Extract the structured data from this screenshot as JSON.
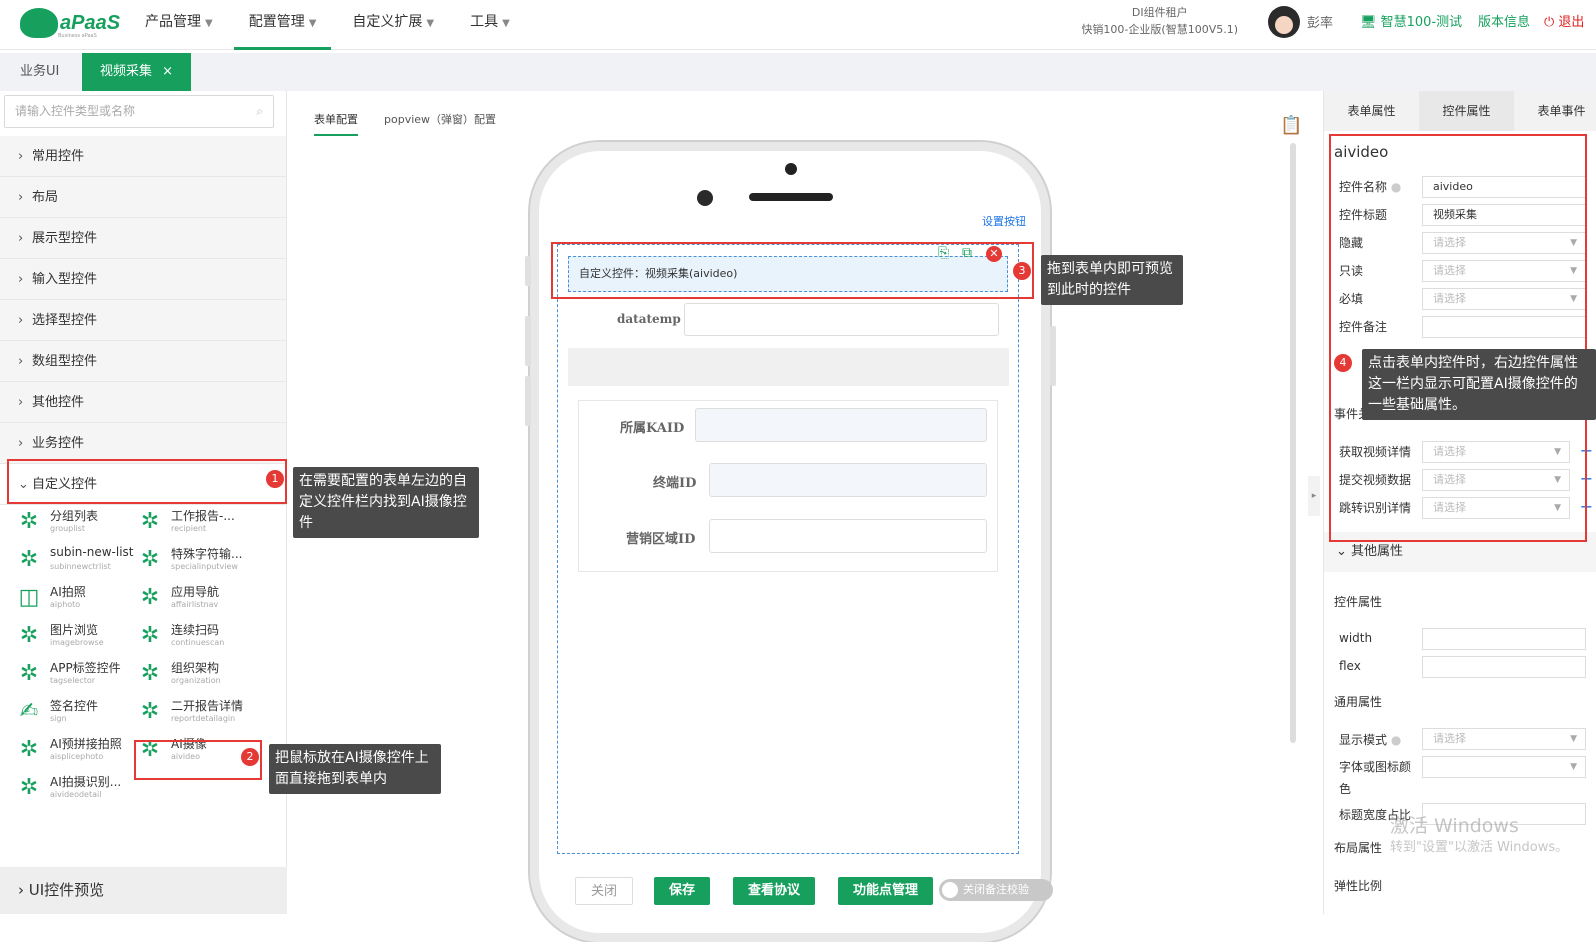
{
  "brand": {
    "name": "aPaaS",
    "sub": "Business aPaaS"
  },
  "nav": {
    "items": [
      "产品管理",
      "配置管理",
      "自定义扩展",
      "工具"
    ],
    "active": 1
  },
  "tenant": {
    "line1": "DI组件租户",
    "line2": "快销100-企业版(智慧100V5.1)"
  },
  "user": {
    "name": "彭率"
  },
  "links": {
    "env": "智慧100-测试",
    "version": "版本信息",
    "logout": "退出"
  },
  "tabs": {
    "t1": "业务UI",
    "t2": "视频采集",
    "close": "×"
  },
  "left": {
    "search_placeholder": "请输入控件类型或名称",
    "categories": [
      "常用控件",
      "布局",
      "展示型控件",
      "输入型控件",
      "选择型控件",
      "数组型控件",
      "其他控件",
      "业务控件",
      "自定义控件"
    ],
    "components": [
      {
        "name": "分组列表",
        "sub": "grouplist"
      },
      {
        "name": "工作报告-...",
        "sub": "recipient"
      },
      {
        "name": "subin-new-list",
        "sub": "subinnewctrlist"
      },
      {
        "name": "特殊字符输...",
        "sub": "specialinputview"
      },
      {
        "name": "AI拍照",
        "sub": "aiphoto"
      },
      {
        "name": "应用导航",
        "sub": "affairlistnav"
      },
      {
        "name": "图片浏览",
        "sub": "imagebrowse"
      },
      {
        "name": "连续扫码",
        "sub": "continuescan"
      },
      {
        "name": "APP标签控件",
        "sub": "tagselector"
      },
      {
        "name": "组织架构",
        "sub": "organization"
      },
      {
        "name": "签名控件",
        "sub": "sign"
      },
      {
        "name": "二开报告详情",
        "sub": "reportdetailagin"
      },
      {
        "name": "AI预拼接拍照",
        "sub": "aisplicephoto"
      },
      {
        "name": "AI摄像",
        "sub": "aivideo"
      },
      {
        "name": "AI拍摄识别...",
        "sub": "aivideodetail"
      }
    ],
    "ui_preview": "UI控件预览"
  },
  "center": {
    "tab1": "表单配置",
    "tab2": "popview（弹窗）配置",
    "set_button": "设置按钮",
    "custom_control": "自定义控件：视频采集(aivideo)",
    "field1": "datatemp",
    "field2": "所属KAID",
    "field3": "终端ID",
    "field4": "营销区域ID"
  },
  "right": {
    "tabs": [
      "表单属性",
      "控件属性",
      "表单事件"
    ],
    "control_id": "aivideo",
    "labels": {
      "name": "控件名称",
      "title": "控件标题",
      "hidden": "隐藏",
      "readonly": "只读",
      "required": "必填",
      "remark": "控件备注",
      "event": "事件关联",
      "ev1": "获取视频详情",
      "ev2": "提交视频数据",
      "ev3": "跳转识别详情",
      "other": "其他属性",
      "ctrl_props": "控件属性",
      "width": "width",
      "flex": "flex",
      "common": "通用属性",
      "display": "显示模式",
      "fontcolor": "字体或图标颜",
      "fontcolor2": "色",
      "titlewidth": "标题宽度占比",
      "layout": "布局属性",
      "elastic": "弹性比例"
    },
    "values": {
      "name": "aivideo",
      "title": "视频采集"
    },
    "placeholder": "请选择"
  },
  "annotations": {
    "a1": "在需要配置的表单左边的自定义控件栏内找到AI摄像控件",
    "a2": "把鼠标放在AI摄像控件上面直接拖到表单内",
    "a3": "拖到表单内即可预览到此时的控件",
    "a4": "点击表单内控件时，右边控件属性这一栏内显示可配置AI摄像控件的一些基础属性。",
    "n1": "1",
    "n2": "2",
    "n3": "3",
    "n4": "4"
  },
  "bottom": {
    "close": "关闭",
    "save": "保存",
    "view": "查看协议",
    "func": "功能点管理",
    "toggle": "关闭备注校验"
  },
  "watermark": {
    "l1": "激活 Windows",
    "l2": "转到\"设置\"以激活 Windows。"
  },
  "colors": {
    "brand": "#17a05d",
    "annotation": "#e53935",
    "link": "#1a73e8"
  }
}
